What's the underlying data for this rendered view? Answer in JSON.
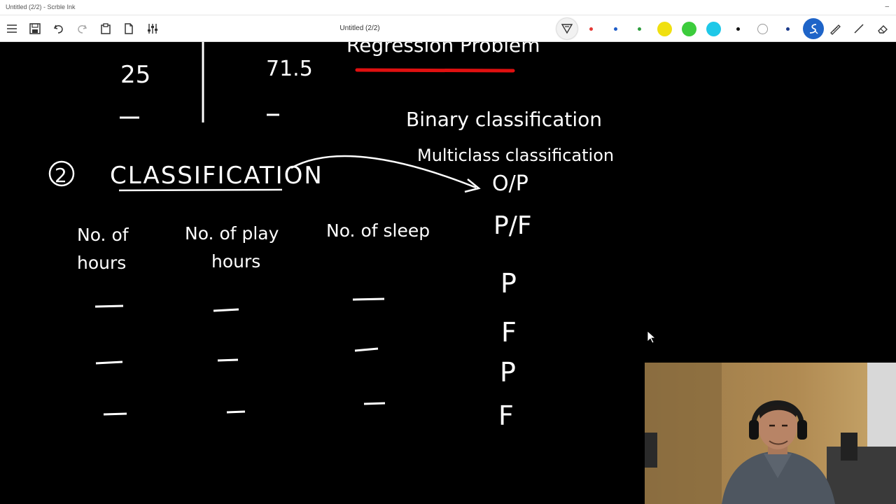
{
  "window": {
    "app_title": "Untitled (2/2) - Scrble Ink",
    "minimize_glyph": "–"
  },
  "toolbar": {
    "document_title": "Untitled (2/2)",
    "tools": [
      "menu-icon",
      "save-icon",
      "undo-icon",
      "redo-icon",
      "paste-icon",
      "page-icon",
      "adjustments-icon",
      "filter-icon",
      "pen-icon",
      "ruler-icon",
      "eraser-icon"
    ],
    "colors": [
      "#e53935",
      "#1e5cc8",
      "#2e9e3e",
      "#f0e010",
      "#3ccc3c",
      "#1ec8e8",
      "#111111",
      "#ffffff",
      "#1a3a8a"
    ],
    "active_color": "#ffffff"
  },
  "board": {
    "top_left_value": "25",
    "top_middle_value": "71.5",
    "regression_text": "Regression Problem",
    "binary_text": "Binary classification",
    "multiclass_text": "Multiclass classification",
    "section_number": "2",
    "section_title": "CLASSIFICATION",
    "output_label": "O/P",
    "output_header": "P/F",
    "outputs": [
      "P",
      "F",
      "P",
      "F"
    ],
    "columns": [
      {
        "line1": "No. of",
        "line2": "hours"
      },
      {
        "line1": "No. of play",
        "line2": "hours"
      },
      {
        "line1": "No. of sleep",
        "line2": ""
      }
    ],
    "accent_underline_color": "#e01010"
  }
}
